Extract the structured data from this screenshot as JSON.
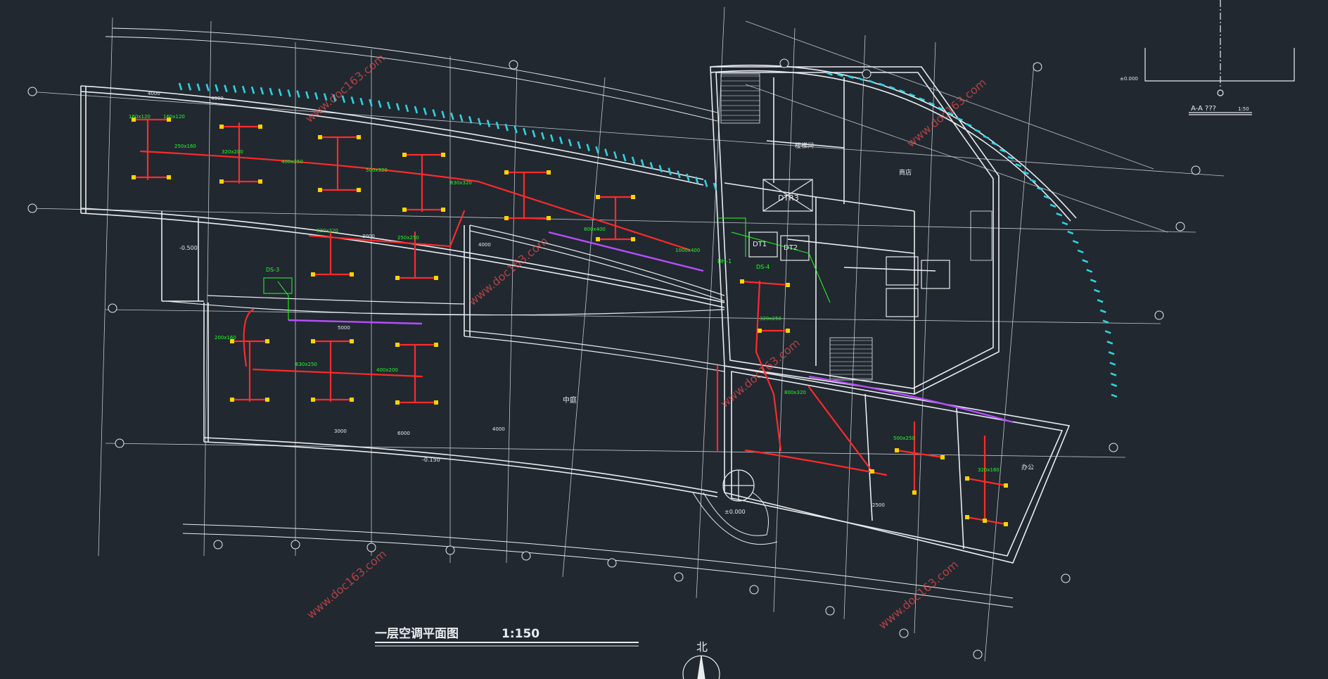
{
  "drawing": {
    "title": "一层空调平面图",
    "scale": "1:150",
    "north_label": "北",
    "section_title": "A-A ???",
    "section_scale": "1:50",
    "section_level": "±0.000",
    "watermark": "www.doc163.com"
  },
  "rooms": {
    "lobby": "中庭",
    "stair_room": "楼梯间",
    "shop": "商店",
    "office": "办公"
  },
  "equipment": {
    "dt1": "DT1",
    "dt2": "DT2",
    "dtr3": "DTR3",
    "dh1": "DH-1",
    "ds3": "DS-3",
    "ds4": "DS-4"
  },
  "duct_labels": [
    "160x120",
    "160x120",
    "250x160",
    "320x200",
    "400x250",
    "500x320",
    "630x320",
    "800x400",
    "1000x400",
    "320x320",
    "250x250",
    "200x160",
    "630x250",
    "400x200",
    "320x250",
    "800x320",
    "500x250",
    "320x160"
  ],
  "dimensions": [
    "4000",
    "4000",
    "3000",
    "5000",
    "4000",
    "3000",
    "6000",
    "4000",
    "2500"
  ],
  "levels": [
    "±0.000",
    "-0.500",
    "-0.150"
  ],
  "colors": {
    "background": "#212830",
    "wall": "#e9ecef",
    "duct": "#ff2a2a",
    "diffuser": "#ffd400",
    "label": "#22ff22",
    "exhaust": "#b84dff",
    "watermark": "#ff5050",
    "louver": "#2ed3e0"
  }
}
